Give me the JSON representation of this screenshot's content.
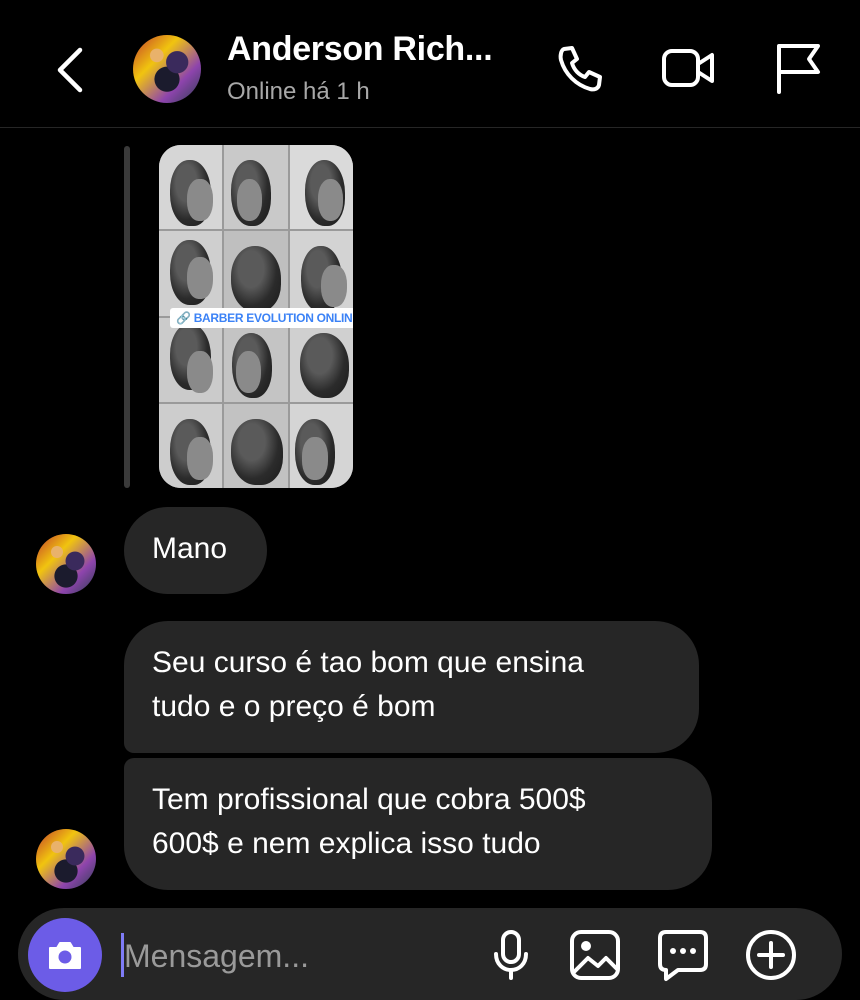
{
  "header": {
    "name": "Anderson Rich...",
    "status": "Online há 1 h"
  },
  "story": {
    "tag": "BARBER EVOLUTION ONLINE"
  },
  "messages": [
    {
      "text": "Mano"
    },
    {
      "line1": "Seu curso é tao bom que ensina",
      "line2": "tudo e o preço é bom"
    },
    {
      "line1": "Tem profissional que cobra 500$",
      "line2": "600$ e nem explica isso tudo"
    }
  ],
  "composer": {
    "placeholder": "Mensagem..."
  },
  "icons": {
    "back": "chevron-left-icon",
    "call": "phone-icon",
    "video": "video-camera-icon",
    "report": "flag-icon",
    "camera": "camera-icon",
    "mic": "microphone-icon",
    "gallery": "image-icon",
    "sticker": "chat-bubble-icon",
    "more": "plus-circle-icon"
  },
  "colors": {
    "background": "#000000",
    "bubble": "#262626",
    "accent": "#6c5ce7"
  }
}
